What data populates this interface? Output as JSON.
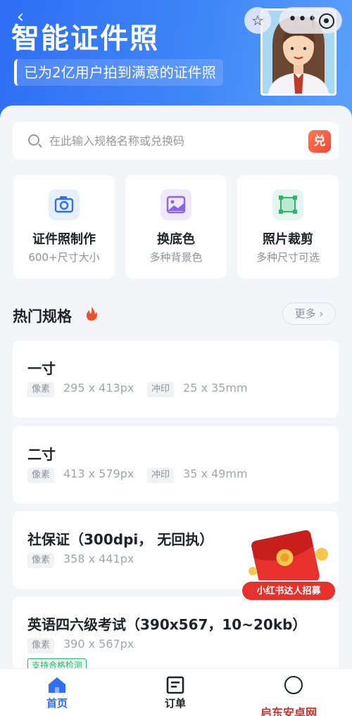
{
  "header": {
    "title": "智能证件照",
    "subtitle": "已为2亿用户拍到满意的证件照"
  },
  "search": {
    "placeholder": "在此输入规格名称或兑换码",
    "redeem_label": "兑"
  },
  "features": [
    {
      "name": "证件照制作",
      "desc": "600+尺寸大小",
      "icon": "camera-icon"
    },
    {
      "name": "换底色",
      "desc": "多种背景色",
      "icon": "picture-icon"
    },
    {
      "name": "照片裁剪",
      "desc": "多种尺寸可选",
      "icon": "crop-icon"
    }
  ],
  "hot": {
    "title": "热门规格",
    "more": "更多 ›"
  },
  "specs": [
    {
      "name": "一寸",
      "pixel_tag": "像素",
      "pixel": "295 x 413px",
      "print_tag": "冲印",
      "print": "25 x 35mm"
    },
    {
      "name": "二寸",
      "pixel_tag": "像素",
      "pixel": "413 x 579px",
      "print_tag": "冲印",
      "print": "35 x 49mm"
    },
    {
      "name": "社保证（300dpi， 无回执）",
      "pixel_tag": "像素",
      "pixel": "358 x 441px"
    },
    {
      "name": "英语四六级考试（390x567，10~20kb）",
      "pixel_tag": "像素",
      "pixel": "390 x 567px",
      "badge": "支持合格检测"
    }
  ],
  "promo": {
    "label": "小红书达人招募"
  },
  "tabbar": {
    "home": "首页",
    "orders": "订单"
  },
  "watermark": "启东安卓网",
  "colors": {
    "accent": "#2f6ef5",
    "redeem": "#f2463a",
    "badge_green": "#2fb36d"
  }
}
